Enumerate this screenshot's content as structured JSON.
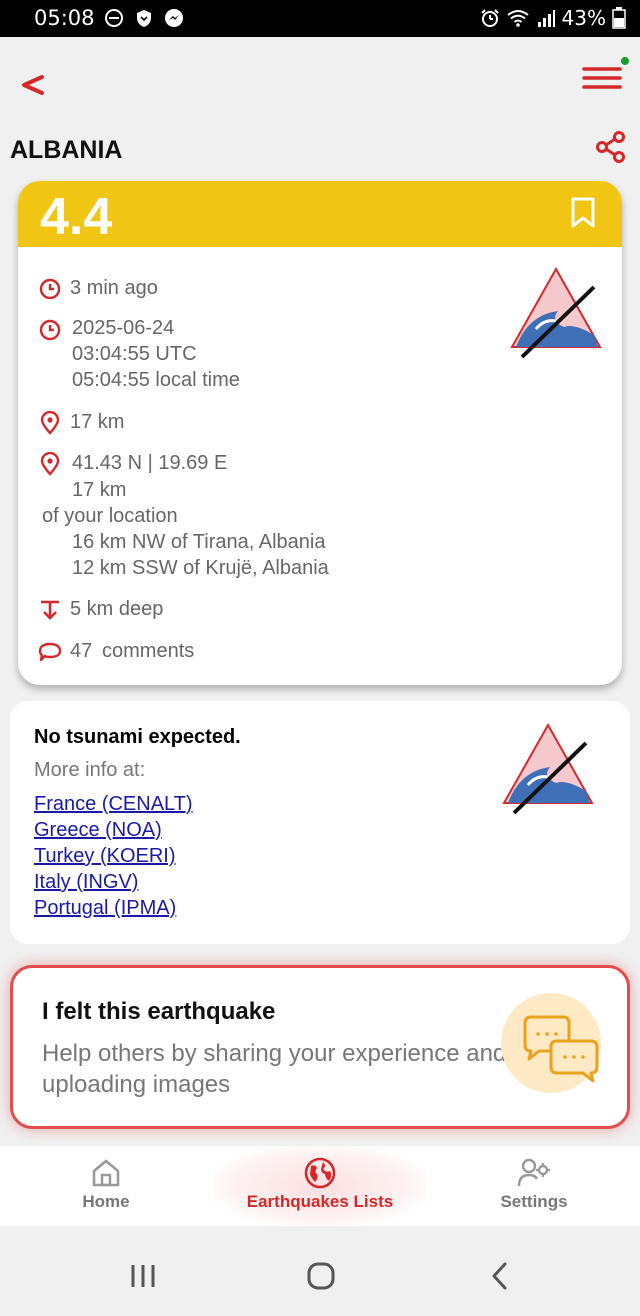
{
  "status_bar": {
    "time": "05:08",
    "battery": "43%",
    "icons": [
      "minus-circle-icon",
      "shield-icon",
      "messenger-icon",
      "alarm-icon",
      "wifi-icon",
      "signal-icon",
      "battery-icon"
    ]
  },
  "header": {
    "back_icon": "back-chevron-icon",
    "menu_icon": "hamburger-menu-icon",
    "country": "ALBANIA",
    "share_icon": "share-icon"
  },
  "quake": {
    "magnitude": "4.4",
    "ago": "3 min ago",
    "date": "2025-06-24",
    "utc_time": "03:04:55 UTC",
    "local_time": "05:04:55 local time",
    "distance": "17 km",
    "coordinates": "41.43 N | 19.69 E",
    "distance_line1": "17 km",
    "distance_line2": "of your location",
    "nearby_1": "16 km NW of Tirana, Albania",
    "nearby_2": "12 km SSW of Krujë, Albania",
    "depth": "5 km deep",
    "comments_count": "47",
    "comments_label": "comments"
  },
  "tsunami": {
    "title": "No tsunami expected.",
    "more_info": "More info at:",
    "links": [
      "France (CENALT)",
      "Greece (NOA)",
      "Turkey (KOERI)",
      "Italy (INGV)",
      "Portugal (IPMA)"
    ]
  },
  "felt": {
    "title": "I felt this earthquake",
    "description": "Help others by sharing your experience and uploading images"
  },
  "bottom_nav": {
    "items": [
      {
        "label": "Home",
        "icon": "home-icon"
      },
      {
        "label": "Earthquakes Lists",
        "icon": "globe-icon"
      },
      {
        "label": "Settings",
        "icon": "user-settings-icon"
      }
    ],
    "active_index": 1
  },
  "colors": {
    "accent_red": "#d4282a",
    "magnitude_yellow": "#f0c514",
    "link_blue": "#1a1aa6"
  }
}
